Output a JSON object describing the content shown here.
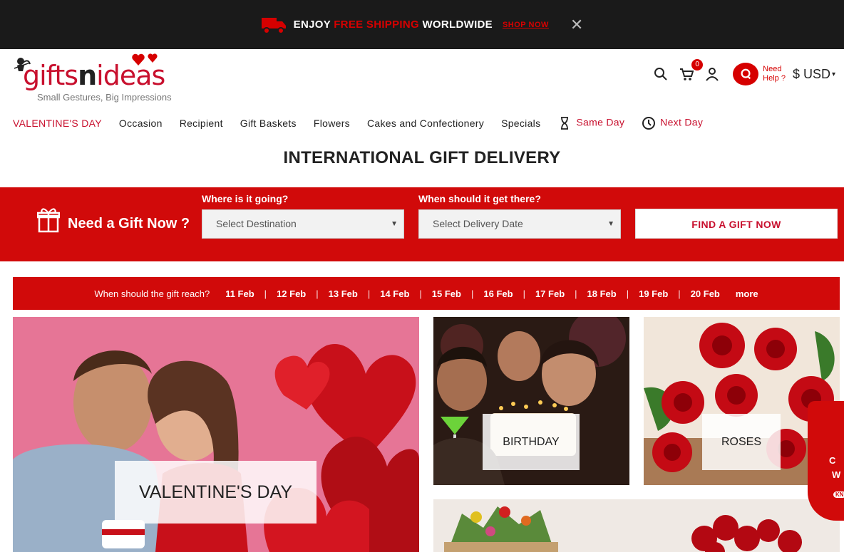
{
  "promo": {
    "text_before": "ENJOY",
    "text_highlight": "FREE SHIPPING",
    "text_after": "WORLDWIDE",
    "shop_label": "SHOP NOW",
    "close_glyph": "✕"
  },
  "logo": {
    "brand_part1": "gifts",
    "brand_part2": "n",
    "brand_part3": "ideas",
    "tagline": "Small Gestures, Big Impressions"
  },
  "header": {
    "cart_count": "0",
    "help_line1": "Need",
    "help_line2": "Help ?",
    "currency": "$ USD",
    "icons": [
      "search-icon",
      "cart-icon",
      "user-icon",
      "chat-icon"
    ]
  },
  "nav": {
    "items": [
      {
        "label": "VALENTINE'S DAY"
      },
      {
        "label": "Occasion"
      },
      {
        "label": "Recipient"
      },
      {
        "label": "Gift Baskets"
      },
      {
        "label": "Flowers"
      },
      {
        "label": "Cakes and Confectionery"
      },
      {
        "label": "Specials"
      },
      {
        "label": "Same Day"
      },
      {
        "label": "Next Day"
      }
    ]
  },
  "headline": "INTERNATIONAL GIFT DELIVERY",
  "finder": {
    "title": "Need a Gift Now ?",
    "dest_label": "Where is it going?",
    "dest_placeholder": "Select Destination",
    "date_label": "When should it get there?",
    "date_placeholder": "Select Delivery Date",
    "button": "FIND A GIFT NOW"
  },
  "dates": {
    "question": "When should the gift reach?",
    "items": [
      "11 Feb",
      "12 Feb",
      "13 Feb",
      "14 Feb",
      "15 Feb",
      "16 Feb",
      "17 Feb",
      "18 Feb",
      "19 Feb",
      "20 Feb"
    ],
    "more": "more",
    "separator": "|"
  },
  "tiles": {
    "valentine": "VALENTINE'S DAY",
    "birthday": "BIRTHDAY",
    "roses": "ROSES"
  },
  "side_tab": {
    "line1": "C",
    "line2": "W",
    "line3": "KN"
  },
  "colors": {
    "brand_red": "#d10a0a",
    "dark_bar": "#1a1a1a",
    "accent_text": "#c8102e"
  }
}
